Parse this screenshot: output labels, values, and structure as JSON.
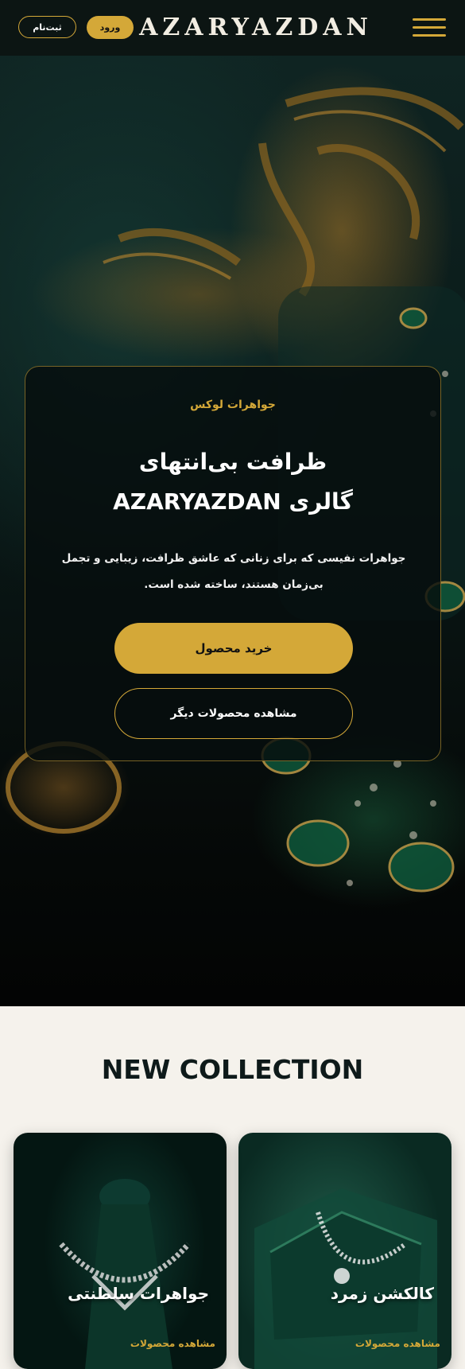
{
  "header": {
    "signup_label": "ثبت‌نام",
    "login_label": "ورود",
    "logo": "AZARYAZDAN",
    "menu_icon": "hamburger-menu-icon"
  },
  "hero": {
    "eyebrow": "جواهرات لوکس",
    "title_line1": "ظرافت بی‌انتهای",
    "title_line2": "گالری AZARYAZDAN",
    "description": "جواهرات نفیسی که برای زنانی که عاشق ظرافت، زیبایی و تجمل بی‌زمان هستند، ساخته شده است.",
    "primary_button": "خرید محصول",
    "secondary_button": "مشاهده محصولات دیگر"
  },
  "collection": {
    "title": "NEW COLLECTION",
    "cards": [
      {
        "title": "کالکشن زمرد",
        "link": "مشاهده محصولات"
      },
      {
        "title": "جواهرات سلطنتی",
        "link": "مشاهده محصولات"
      }
    ]
  },
  "colors": {
    "accent": "#d4a838",
    "header_bg": "#0c1513",
    "dark_text": "#0e1a1a",
    "page_bg": "#f5f2ec"
  }
}
